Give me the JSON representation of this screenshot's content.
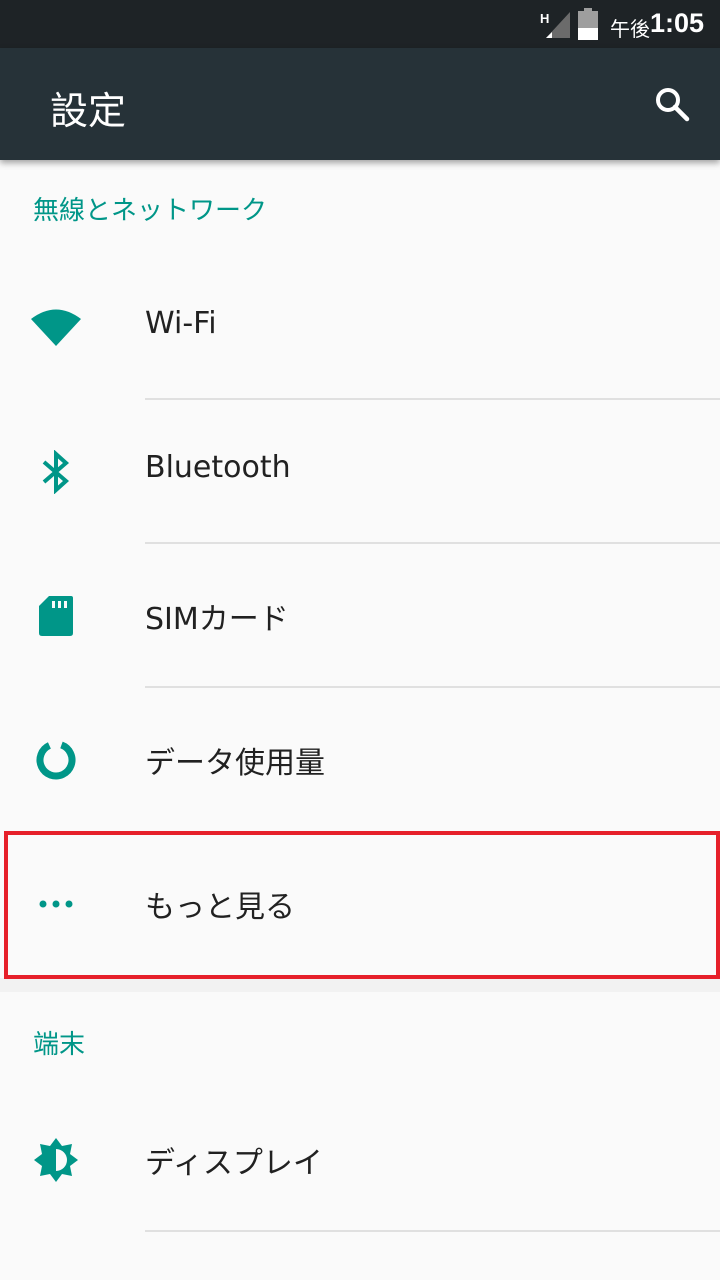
{
  "status_bar": {
    "network_type": "H",
    "time_prefix": "午後",
    "time": "1:05"
  },
  "app_bar": {
    "title": "設定",
    "search_icon": "search-icon"
  },
  "sections": [
    {
      "header": "無線とネットワーク",
      "items": [
        {
          "label": "Wi-Fi",
          "icon": "wifi-icon"
        },
        {
          "label": "Bluetooth",
          "icon": "bluetooth-icon"
        },
        {
          "label": "SIMカード",
          "icon": "sim-card-icon"
        },
        {
          "label": "データ使用量",
          "icon": "data-usage-icon"
        },
        {
          "label": "もっと見る",
          "icon": "more-icon"
        }
      ]
    },
    {
      "header": "端末",
      "items": [
        {
          "label": "ディスプレイ",
          "icon": "display-icon"
        }
      ]
    }
  ],
  "colors": {
    "accent": "#009688",
    "app_bar": "#263238",
    "status_bar": "#1e2326",
    "highlight": "#e6202a"
  }
}
